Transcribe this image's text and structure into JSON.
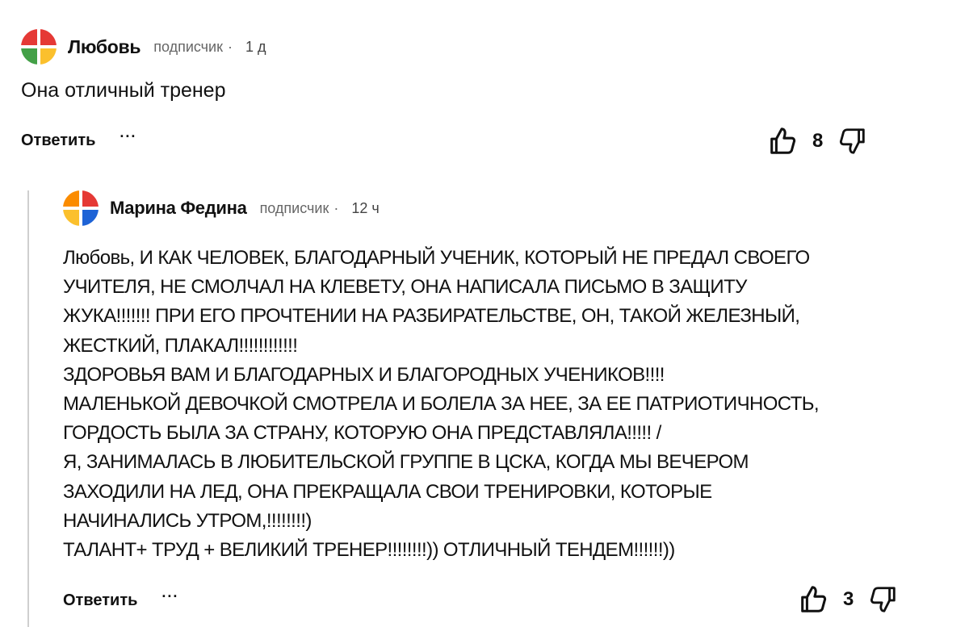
{
  "comments": [
    {
      "author": "Любовь",
      "role": "подписчик",
      "separator": "·",
      "time": "1 д",
      "text": "Она отличный тренер",
      "reply_label": "Ответить",
      "more_label": "···",
      "likes": "8",
      "avatar_colors": [
        "#e53935",
        "#43a047",
        "#fbc02d"
      ]
    },
    {
      "author": "Марина Федина",
      "role": "подписчик",
      "separator": "·",
      "time": "12 ч",
      "lines": [
        "Любовь, И КАК ЧЕЛОВЕК, БЛАГОДАРНЫЙ УЧЕНИК, КОТОРЫЙ НЕ ПРЕДАЛ СВОЕГО",
        "УЧИТЕЛЯ, НЕ СМОЛЧАЛ НА КЛЕВЕТУ, ОНА  НАПИСАЛА ПИСЬМО В ЗАЩИТУ",
        "ЖУКА!!!!!!! ПРИ ЕГО ПРОЧТЕНИИ НА РАЗБИРАТЕЛЬСТВЕ, ОН, ТАКОЙ ЖЕЛЕЗНЫЙ,",
        "ЖЕСТКИЙ, ПЛАКАЛ!!!!!!!!!!!!",
        "ЗДОРОВЬЯ ВАМ И БЛАГОДАРНЫХ И БЛАГОРОДНЫХ УЧЕНИКОВ!!!!",
        "МАЛЕНЬКОЙ ДЕВОЧКОЙ СМОТРЕЛА И БОЛЕЛА ЗА НЕЕ, ЗА  ЕЕ ПАТРИОТИЧНОСТЬ,",
        "ГОРДОСТЬ БЫЛА ЗА СТРАНУ, КОТОРУЮ ОНА ПРЕДСТАВЛЯЛА!!!!! /",
        "Я, ЗАНИМАЛАСЬ В ЛЮБИТЕЛЬСКОЙ ГРУППЕ В ЦСКА, КОГДА МЫ ВЕЧЕРОМ",
        "ЗАХОДИЛИ НА ЛЕД, ОНА ПРЕКРАЩАЛА СВОИ ТРЕНИРОВКИ, КОТОРЫЕ",
        "НАЧИНАЛИСЬ УТРОМ,!!!!!!!!)",
        "ТАЛАНТ+ ТРУД + ВЕЛИКИЙ ТРЕНЕР!!!!!!!!)) ОТЛИЧНЫЙ ТЕНДЕМ!!!!!!))"
      ],
      "reply_label": "Ответить",
      "more_label": "···",
      "likes": "3",
      "avatar_colors": [
        "#e53935",
        "#1e63d6",
        "#fbc02d"
      ]
    }
  ]
}
